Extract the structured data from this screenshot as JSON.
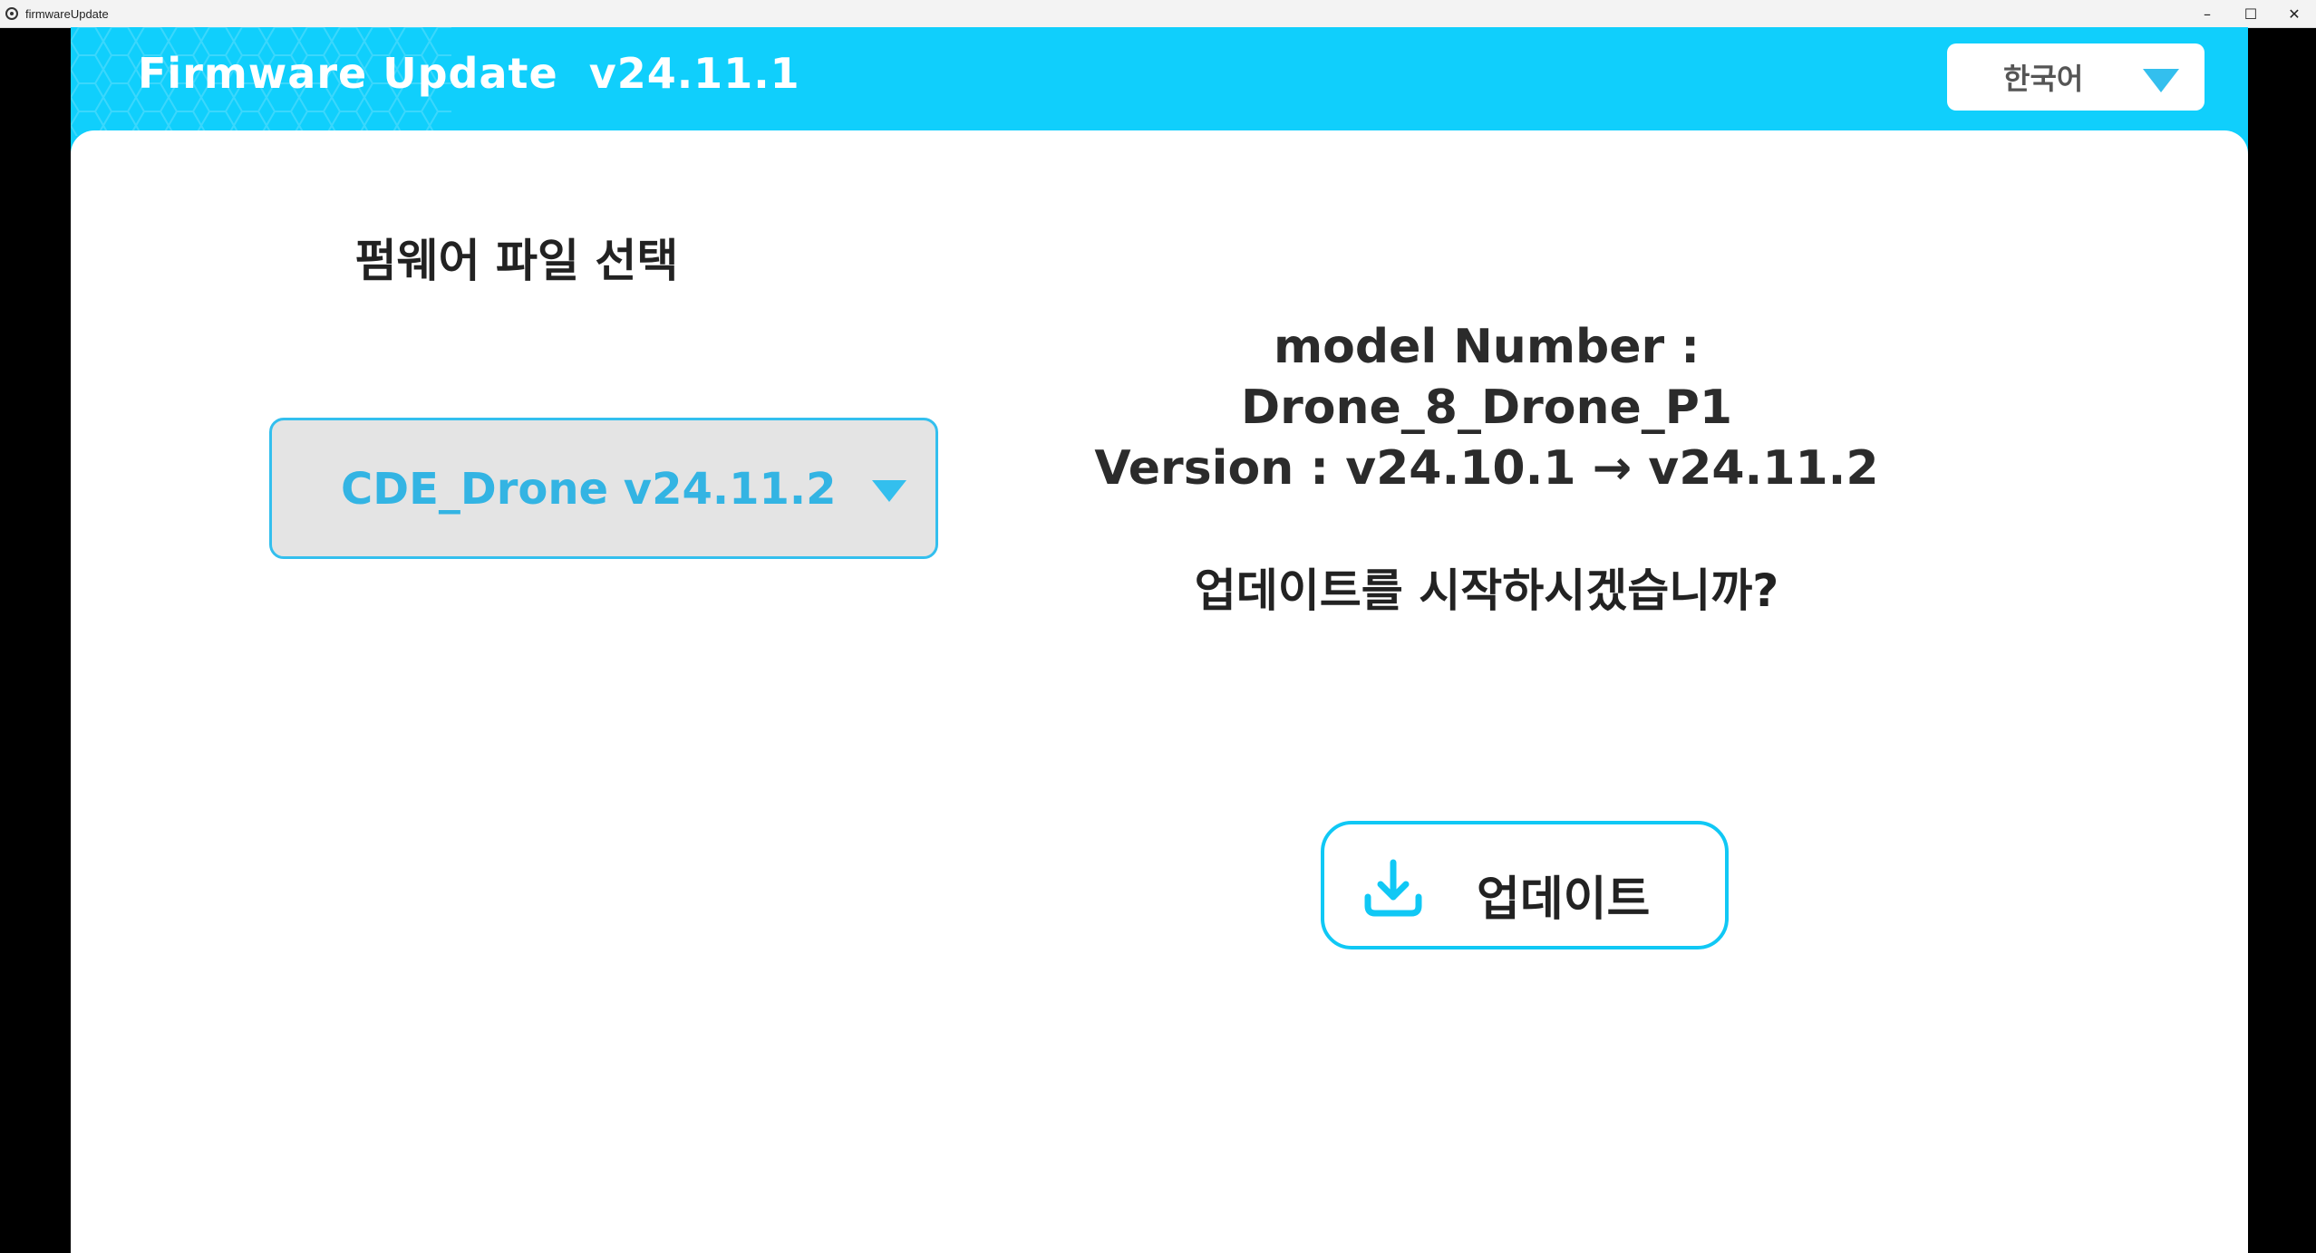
{
  "window": {
    "title": "firmwareUpdate",
    "controls": [
      "–",
      "☐",
      "✕"
    ]
  },
  "header": {
    "title": "Firmware Update  v24.11.1",
    "language": "한국어"
  },
  "left": {
    "heading": "펌웨어 파일 선택",
    "selected_file": "CDE_Drone v24.11.2"
  },
  "info": {
    "line1": "model Number :",
    "line2": "Drone_8_Drone_P1",
    "line3": "Version : v24.10.1 → v24.11.2",
    "confirm": "업데이트를 시작하시겠습니까?"
  },
  "update_button": {
    "label": "업데이트"
  },
  "colors": {
    "accent": "#10cffc",
    "select_text": "#33b4e3",
    "select_bg": "#e4e4e4"
  },
  "icons": {
    "language_dropdown": "chevron-down-icon",
    "file_dropdown": "chevron-down-icon",
    "update": "download-icon"
  }
}
